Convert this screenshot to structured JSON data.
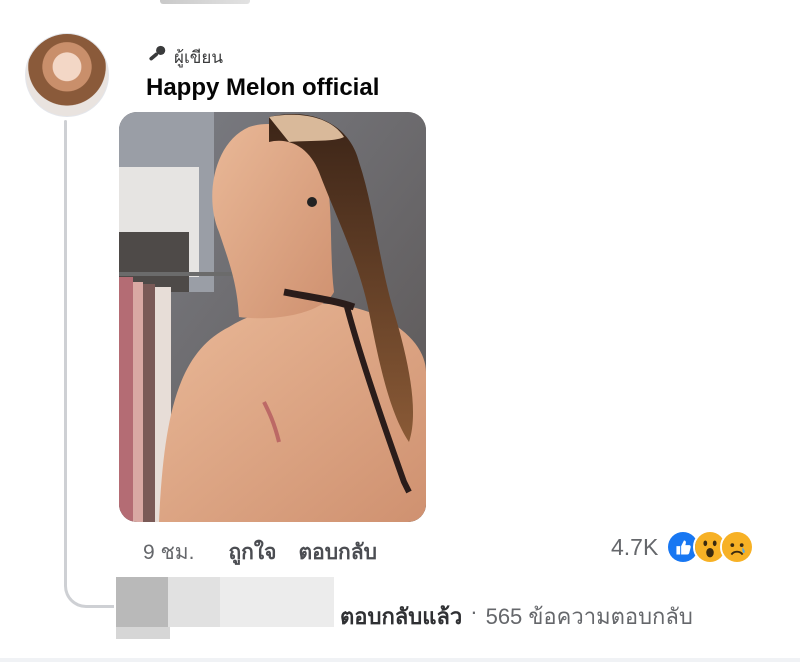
{
  "comment": {
    "author_badge_label": "ผู้เขียน",
    "author_name": "Happy Melon official",
    "timestamp": "9 ชม.",
    "like_label": "ถูกใจ",
    "reply_label": "ตอบกลับ",
    "reaction_count": "4.7K",
    "reactions": [
      "like-reaction-icon",
      "wow-reaction-icon",
      "sad-reaction-icon"
    ]
  },
  "replies": {
    "status_label": "ตอบกลับแล้ว",
    "separator": "·",
    "count_label": "565 ข้อความตอบกลับ"
  },
  "colors": {
    "like_blue": "#1877f2",
    "emoji_yellow": "#f7b125",
    "secondary_text": "#65676b"
  }
}
